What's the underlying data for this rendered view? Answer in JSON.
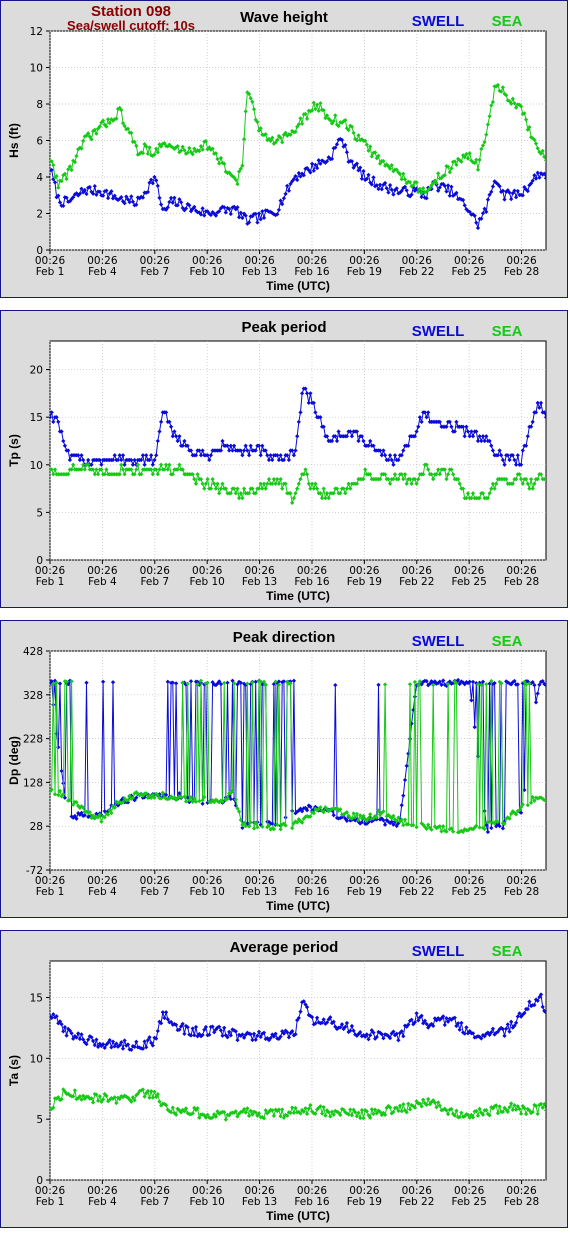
{
  "station": {
    "name": "Station 098",
    "cutoff": "Sea/swell cutoff: 10s"
  },
  "legend": {
    "swell": "SWELL",
    "sea": "SEA"
  },
  "colors": {
    "swell": "#0b0bd9",
    "sea": "#17c917",
    "panel": "#dcdcdc",
    "frame": "#16168a"
  },
  "x_axis": {
    "label": "Time (UTC)",
    "ticks": [
      {
        "day": 1,
        "time": "00:26",
        "date": "Feb 1"
      },
      {
        "day": 4,
        "time": "00:26",
        "date": "Feb 4"
      },
      {
        "day": 7,
        "time": "00:26",
        "date": "Feb 7"
      },
      {
        "day": 10,
        "time": "00:26",
        "date": "Feb 10"
      },
      {
        "day": 13,
        "time": "00:26",
        "date": "Feb 13"
      },
      {
        "day": 16,
        "time": "00:26",
        "date": "Feb 16"
      },
      {
        "day": 19,
        "time": "00:26",
        "date": "Feb 19"
      },
      {
        "day": 22,
        "time": "00:26",
        "date": "Feb 22"
      },
      {
        "day": 25,
        "time": "00:26",
        "date": "Feb 25"
      },
      {
        "day": 28,
        "time": "00:26",
        "date": "Feb 28"
      }
    ],
    "range": [
      1,
      29.4
    ]
  },
  "chart_data": [
    {
      "type": "line",
      "title": "Wave height",
      "ylabel": "Hs (ft)",
      "ylim": [
        0,
        12
      ],
      "yticks": [
        0,
        2,
        4,
        6,
        8,
        10,
        12
      ],
      "x": [
        1,
        1.5,
        2,
        3,
        4,
        5,
        6,
        6.5,
        7,
        7.5,
        8,
        9,
        10,
        11,
        11.7,
        12,
        12.3,
        13,
        14,
        15,
        16,
        16.5,
        17,
        17.7,
        18,
        19,
        20,
        21,
        22,
        22.5,
        23,
        24,
        25,
        25.5,
        26,
        26.5,
        27,
        28,
        29,
        29.4
      ],
      "series": [
        {
          "name": "SWELL",
          "values": [
            4.5,
            2.7,
            2.6,
            3.3,
            3.2,
            2.8,
            2.6,
            3.3,
            4.0,
            2.0,
            2.7,
            2.3,
            2.0,
            2.2,
            2.2,
            1.8,
            1.6,
            1.8,
            2.2,
            4.0,
            4.5,
            4.8,
            5.0,
            6.2,
            5.2,
            4.0,
            3.5,
            3.2,
            3.2,
            3.0,
            3.6,
            3.2,
            2.2,
            1.4,
            2.3,
            4.0,
            3.0,
            3.1,
            4.2,
            4.1
          ]
        },
        {
          "name": "SEA",
          "values": [
            5.0,
            3.6,
            4.2,
            6.0,
            6.8,
            7.6,
            5.4,
            5.6,
            5.3,
            5.8,
            5.6,
            5.4,
            5.8,
            4.5,
            3.8,
            4.5,
            8.8,
            6.5,
            6.0,
            6.5,
            7.8,
            7.8,
            7.2,
            7.0,
            6.8,
            5.8,
            4.8,
            4.2,
            3.5,
            3.0,
            3.8,
            4.6,
            5.2,
            4.6,
            6.5,
            9.0,
            8.6,
            7.6,
            5.3,
            5.1
          ]
        }
      ]
    },
    {
      "type": "line",
      "title": "Peak period",
      "ylabel": "Tp (s)",
      "ylim": [
        0,
        23
      ],
      "yticks": [
        0,
        5,
        10,
        15,
        20
      ],
      "x": [
        1,
        1.5,
        2,
        3,
        4,
        5,
        6,
        7,
        7.5,
        8,
        9,
        10,
        11,
        12,
        13,
        14,
        15,
        15.5,
        16,
        17,
        18,
        19,
        20,
        21,
        22,
        22.5,
        23,
        24,
        25,
        26,
        27,
        28,
        28.5,
        29,
        29.4
      ],
      "series": [
        {
          "name": "SWELL",
          "values": [
            15.2,
            14.5,
            10.8,
            10.5,
            10.5,
            10.5,
            10.5,
            10.5,
            15.5,
            13.5,
            11.5,
            11.0,
            12.0,
            11.5,
            11.5,
            10.5,
            11.0,
            18.2,
            16.5,
            12.5,
            13.5,
            12.5,
            11.0,
            10.5,
            14.0,
            15.5,
            14.0,
            14.0,
            13.5,
            12.5,
            10.5,
            10.5,
            14.5,
            16.5,
            15.5
          ]
        },
        {
          "name": "SEA",
          "values": [
            9.5,
            9.0,
            9.5,
            9.5,
            9.0,
            9.5,
            9.5,
            9.5,
            9.5,
            9.5,
            9.0,
            8.0,
            7.5,
            7.0,
            7.5,
            8.5,
            6.0,
            9.5,
            7.5,
            7.0,
            7.5,
            9.0,
            8.5,
            8.5,
            8.5,
            9.5,
            9.0,
            9.0,
            6.5,
            7.0,
            8.5,
            8.5,
            8.0,
            8.5,
            9.0
          ]
        }
      ]
    },
    {
      "type": "line",
      "title": "Peak direction",
      "ylabel": "Dp (deg)",
      "ylim": [
        -72,
        428
      ],
      "yticks": [
        -72,
        28,
        128,
        228,
        328,
        428
      ],
      "x": [
        1,
        2,
        3,
        4,
        5,
        6,
        7,
        8,
        9,
        10,
        11,
        11.5,
        12,
        13,
        14,
        15,
        16,
        17,
        18,
        19,
        20,
        21,
        22,
        23,
        24,
        25,
        26,
        27,
        28,
        29,
        29.4
      ],
      "series": [
        {
          "name": "SWELL",
          "values": [
            355,
            55,
            50,
            55,
            85,
            95,
            95,
            100,
            90,
            85,
            85,
            95,
            30,
            35,
            30,
            60,
            70,
            60,
            45,
            40,
            40,
            30,
            355,
            355,
            355,
            355,
            20,
            30,
            60,
            355,
            355
          ]
        },
        {
          "name": "SEA",
          "values": [
            110,
            95,
            60,
            45,
            85,
            100,
            100,
            95,
            90,
            90,
            90,
            110,
            30,
            30,
            25,
            30,
            60,
            70,
            55,
            45,
            60,
            40,
            30,
            25,
            20,
            20,
            30,
            40,
            70,
            100,
            90
          ]
        }
      ]
    },
    {
      "type": "line",
      "title": "Average period",
      "ylabel": "Ta (s)",
      "ylim": [
        0,
        18
      ],
      "yticks": [
        0,
        5,
        10,
        15
      ],
      "x": [
        1,
        2,
        3,
        4,
        5,
        6,
        7,
        7.5,
        8,
        9,
        10,
        11,
        12,
        13,
        14,
        15,
        15.5,
        16,
        17,
        18,
        19,
        20,
        21,
        22,
        22.5,
        23,
        24,
        25,
        26,
        27,
        28,
        29,
        29.4
      ],
      "series": [
        {
          "name": "SWELL",
          "values": [
            13.6,
            12.2,
            11.5,
            11.2,
            11.2,
            11.0,
            11.5,
            13.8,
            12.8,
            12.2,
            12.2,
            12.2,
            11.8,
            11.8,
            11.8,
            12.0,
            14.6,
            13.0,
            13.0,
            12.5,
            12.0,
            11.8,
            11.8,
            13.5,
            12.8,
            13.0,
            13.2,
            12.0,
            12.0,
            12.2,
            13.5,
            15.2,
            14.0
          ]
        },
        {
          "name": "SEA",
          "values": [
            6.0,
            7.5,
            6.5,
            6.8,
            6.5,
            7.0,
            7.2,
            6.0,
            5.8,
            5.6,
            5.4,
            5.2,
            5.6,
            5.5,
            5.4,
            5.6,
            5.6,
            5.8,
            5.6,
            5.5,
            5.4,
            5.6,
            5.8,
            6.2,
            6.5,
            6.4,
            5.6,
            5.4,
            5.6,
            6.0,
            5.8,
            5.8,
            6.0
          ]
        }
      ]
    }
  ]
}
